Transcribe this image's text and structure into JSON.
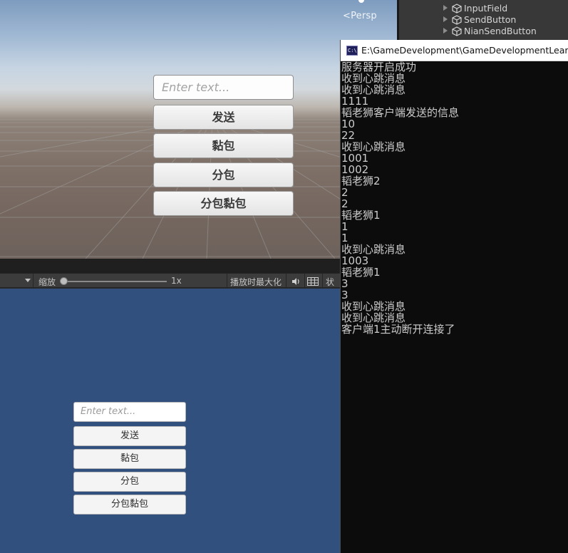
{
  "scene_view": {
    "persp_label": "<Persp",
    "world_ui": {
      "input_placeholder": "Enter text...",
      "buttons": [
        "发送",
        "黏包",
        "分包",
        "分包黏包"
      ]
    }
  },
  "game_toolbar": {
    "scale_label": "缩放",
    "scale_value": "1x",
    "maximize_label": "播放时最大化",
    "gizmos_label": "状态"
  },
  "game_view": {
    "input_placeholder": "Enter text...",
    "buttons": [
      "发送",
      "黏包",
      "分包",
      "分包黏包"
    ]
  },
  "hierarchy": {
    "items": [
      "InputField",
      "SendButton",
      "NianSendButton"
    ]
  },
  "console": {
    "icon_text": "C:\\",
    "title": "E:\\GameDevelopment\\GameDevelopmentLearning",
    "lines": [
      "服务器开启成功",
      "收到心跳消息",
      "收到心跳消息",
      "1111",
      "韬老狮客户端发送的信息",
      "10",
      "22",
      "收到心跳消息",
      "1001",
      "1002",
      "韬老狮2",
      "2",
      "2",
      "韬老狮1",
      "1",
      "1",
      "收到心跳消息",
      "1003",
      "韬老狮1",
      "3",
      "3",
      "收到心跳消息",
      "收到心跳消息",
      "客户端1主动断开连接了"
    ]
  },
  "colors": {
    "game_background": "#31507e",
    "console_background": "#0c0c0c",
    "console_text": "#cccccc"
  }
}
